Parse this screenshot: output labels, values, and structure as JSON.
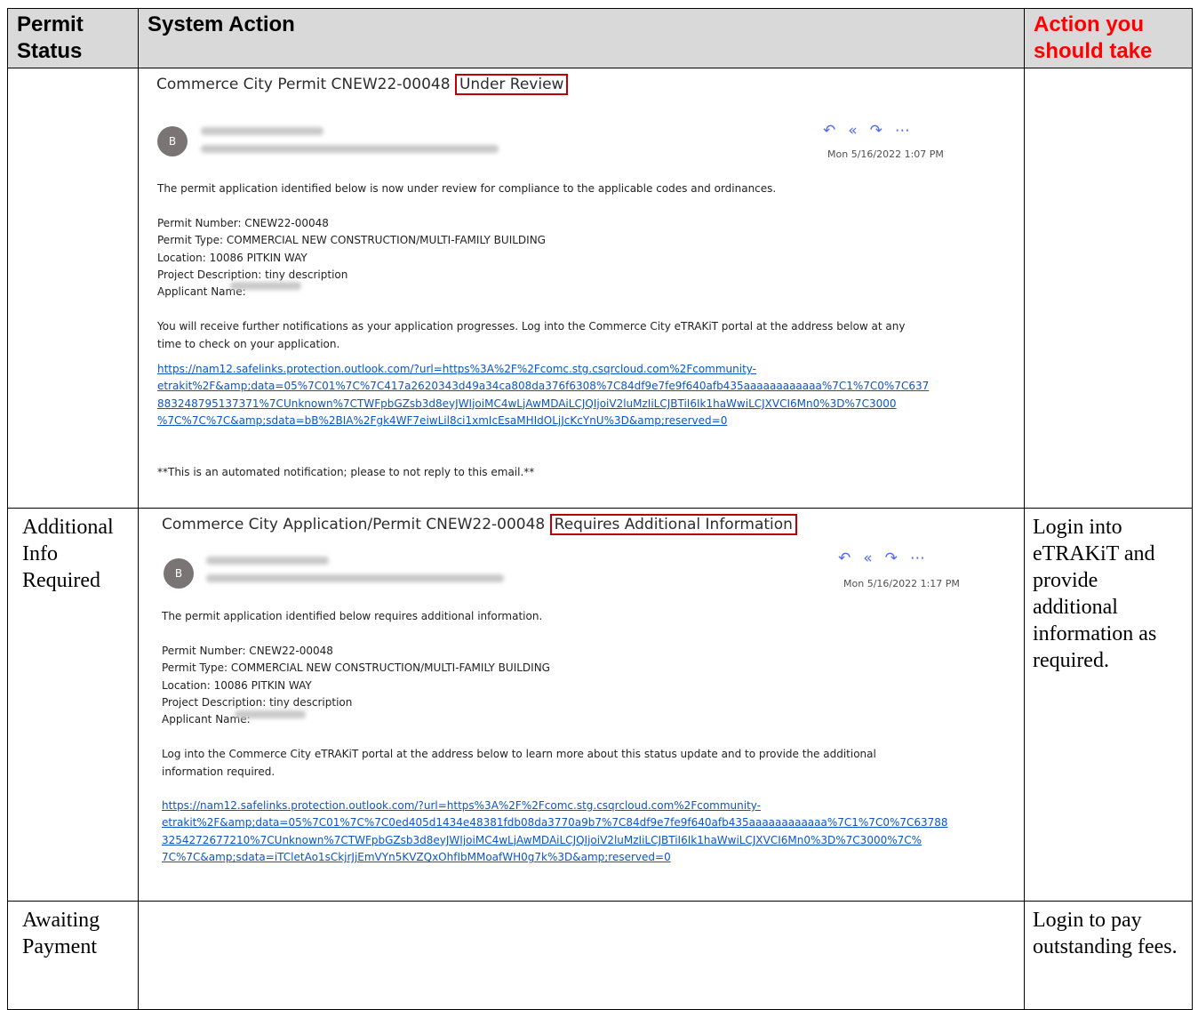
{
  "headers": {
    "status": "Permit Status",
    "action": "System Action",
    "you": "Action you should take"
  },
  "rows": [
    {
      "status": "",
      "you": "",
      "email": {
        "subject_prefix": "Commerce City Permit CNEW22-00048",
        "subject_status": "Under Review",
        "avatar": "B",
        "date": "Mon 5/16/2022 1:07 PM",
        "intro": "The permit application identified below is now under review for compliance to the applicable codes and ordinances.",
        "permit_number": "Permit Number: CNEW22-00048",
        "permit_type": "Permit Type: COMMERCIAL NEW CONSTRUCTION/MULTI-FAMILY BUILDING",
        "location": "Location: 10086 PITKIN WAY",
        "project": "Project Description: tiny description",
        "applicant": "Applicant Name:",
        "note_1": "You will receive further notifications as your application progresses.  Log into the Commerce City eTRAKiT portal at the address below at any",
        "note_2": "time to check on your application.",
        "link_1": "https://nam12.safelinks.protection.outlook.com/?url=https%3A%2F%2Fcomc.stg.csqrcloud.com%2Fcommunity-",
        "link_2": "etrakit%2F&amp;data=05%7C01%7C%7C417a2620343d49a34ca808da376f6308%7C84df9e7fe9f640afb435aaaaaaaaaaaa%7C1%7C0%7C637",
        "link_3": "883248795137371%7CUnknown%7CTWFpbGZsb3d8eyJWIjoiMC4wLjAwMDAiLCJQIjoiV2luMzIiLCJBTiI6Ik1haWwiLCJXVCI6Mn0%3D%7C3000",
        "link_4": "%7C%7C%7C&amp;sdata=bB%2BIA%2Fgk4WF7eiwLil8ci1xmIcEsaMHIdOLjJcKcYnU%3D&amp;reserved=0",
        "footer": "**This is an automated notification; please to not reply to this email.**"
      }
    },
    {
      "status": "Additional Info Required",
      "you": "Login into eTRAKiT and provide additional information as required.",
      "email": {
        "subject_prefix": "Commerce City Application/Permit CNEW22-00048",
        "subject_status": "Requires Additional Information",
        "avatar": "B",
        "date": "Mon 5/16/2022 1:17 PM",
        "intro": "The permit application identified below requires additional information.",
        "permit_number": "Permit Number: CNEW22-00048",
        "permit_type": "Permit Type: COMMERCIAL NEW CONSTRUCTION/MULTI-FAMILY BUILDING",
        "location": "Location: 10086 PITKIN WAY",
        "project": "Project Description: tiny description",
        "applicant": "Applicant Name:",
        "note_1": "Log into the Commerce City eTRAKiT portal at the address below to learn more about this status update and to provide the additional",
        "note_2": "information required.",
        "link_1": "https://nam12.safelinks.protection.outlook.com/?url=https%3A%2F%2Fcomc.stg.csqrcloud.com%2Fcommunity-",
        "link_2": "etrakit%2F&amp;data=05%7C01%7C%7C0ed405d1434e48381fdb08da3770a9b7%7C84df9e7fe9f640afb435aaaaaaaaaaaa%7C1%7C0%7C63788",
        "link_3": "3254272677210%7CUnknown%7CTWFpbGZsb3d8eyJWIjoiMC4wLjAwMDAiLCJQIjoiV2luMzIiLCJBTiI6Ik1haWwiLCJXVCI6Mn0%3D%7C3000%7C%",
        "link_4": "7C%7C&amp;sdata=iTCletAo1sCkjrJjEmVYn5KVZQxOhfIbMMoafWH0g7k%3D&amp;reserved=0"
      }
    },
    {
      "status": "Awaiting Payment",
      "you": "Login to pay outstanding fees."
    }
  ],
  "icons": {
    "reply": "reply-icon",
    "reply_all": "reply-all-icon",
    "forward": "forward-icon",
    "more": "more-icon"
  },
  "colors": {
    "header_bg": "#d9d9d9",
    "action_header": "#ff0000",
    "status_box": "#c00000",
    "link": "#1a0dab",
    "avatar": "#7a7574"
  }
}
